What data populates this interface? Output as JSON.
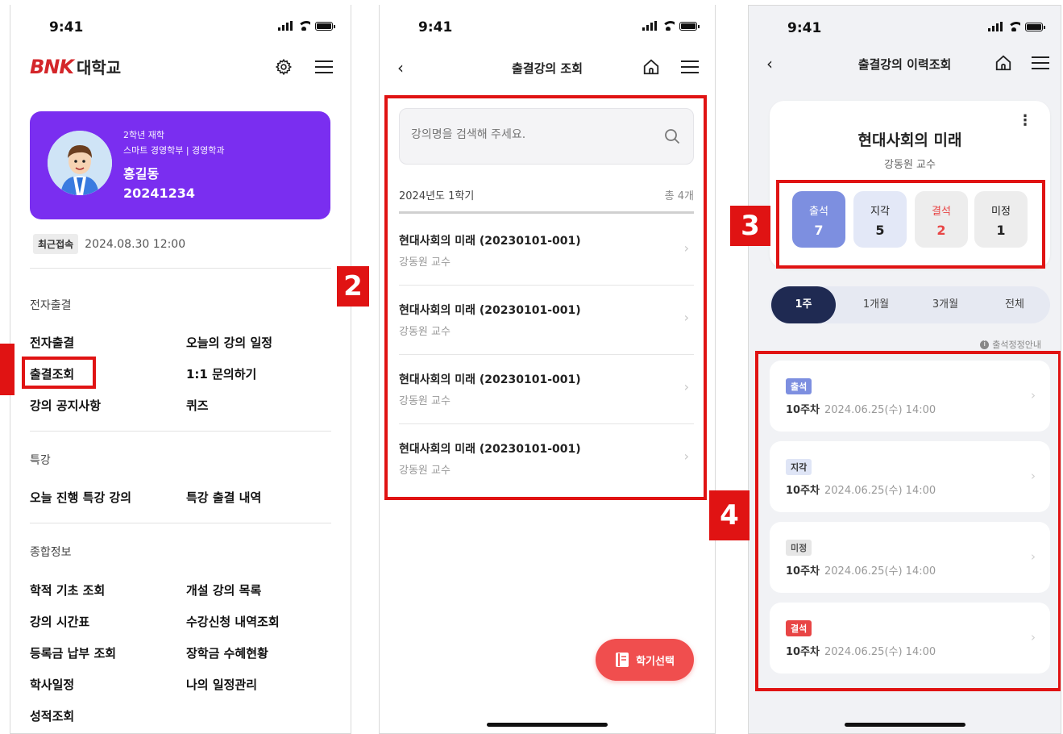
{
  "status_time": "9:41",
  "phone1": {
    "brand": "BNK",
    "univ": "대학교",
    "profile": {
      "grade": "2학년 재학",
      "dept": "스마트 경영학부 | 경영학과",
      "name": "홍길동",
      "student_id": "20241234"
    },
    "recent_label": "최근접속",
    "recent_value": "2024.08.30 12:00",
    "sections": {
      "e_attend": "전자출결",
      "special": "특강",
      "general": "종합정보"
    },
    "menu": {
      "e_attend": "전자출결",
      "today_schedule": "오늘의 강의 일정",
      "attend_check": "출결조회",
      "inquiry": "1:1 문의하기",
      "notice": "강의 공지사항",
      "quiz": "퀴즈",
      "today_special": "오늘 진행 특강 강의",
      "special_attend": "특강 출결 내역",
      "academic_basic": "학적 기초 조회",
      "course_list": "개설 강의 목록",
      "timetable": "강의 시간표",
      "enroll_history": "수강신청 내역조회",
      "tuition": "등록금 납부 조회",
      "scholarship": "장학금 수혜현황",
      "academic_calendar": "학사일정",
      "my_schedule": "나의 일정관리",
      "grades": "성적조회"
    }
  },
  "phone2": {
    "title": "출결강의 조회",
    "search_placeholder": "강의명을 검색해 주세요.",
    "term": "2024년도 1학기",
    "count": "총 4개",
    "courses": [
      {
        "title": "현대사회의 미래 (20230101-001)",
        "prof": "강동원 교수"
      },
      {
        "title": "현대사회의 미래 (20230101-001)",
        "prof": "강동원 교수"
      },
      {
        "title": "현대사회의 미래 (20230101-001)",
        "prof": "강동원 교수"
      },
      {
        "title": "현대사회의 미래 (20230101-001)",
        "prof": "강동원 교수"
      }
    ],
    "fab_label": "학기선택"
  },
  "phone3": {
    "title": "출결강의 이력조회",
    "course_title": "현대사회의 미래",
    "prof": "강동원 교수",
    "stats": [
      {
        "label": "출석",
        "value": "7"
      },
      {
        "label": "지각",
        "value": "5"
      },
      {
        "label": "결석",
        "value": "2"
      },
      {
        "label": "미정",
        "value": "1"
      }
    ],
    "periods": [
      "1주",
      "1개월",
      "3개월",
      "전체"
    ],
    "guide": "출석정정안내",
    "records": [
      {
        "tag": "출석",
        "week": "10주차",
        "date": "2024.06.25(수) 14:00"
      },
      {
        "tag": "지각",
        "week": "10주차",
        "date": "2024.06.25(수) 14:00"
      },
      {
        "tag": "미정",
        "week": "10주차",
        "date": "2024.06.25(수) 14:00"
      },
      {
        "tag": "결석",
        "week": "10주차",
        "date": "2024.06.25(수) 14:00"
      }
    ]
  },
  "callouts": [
    "2",
    "3",
    "4"
  ],
  "colors": {
    "profile_bg": "#7a2ef0",
    "annotation_red": "#e01313",
    "fab_red": "#f04e4e",
    "period_active": "#1f2a52",
    "brand_red": "#d4262a"
  }
}
